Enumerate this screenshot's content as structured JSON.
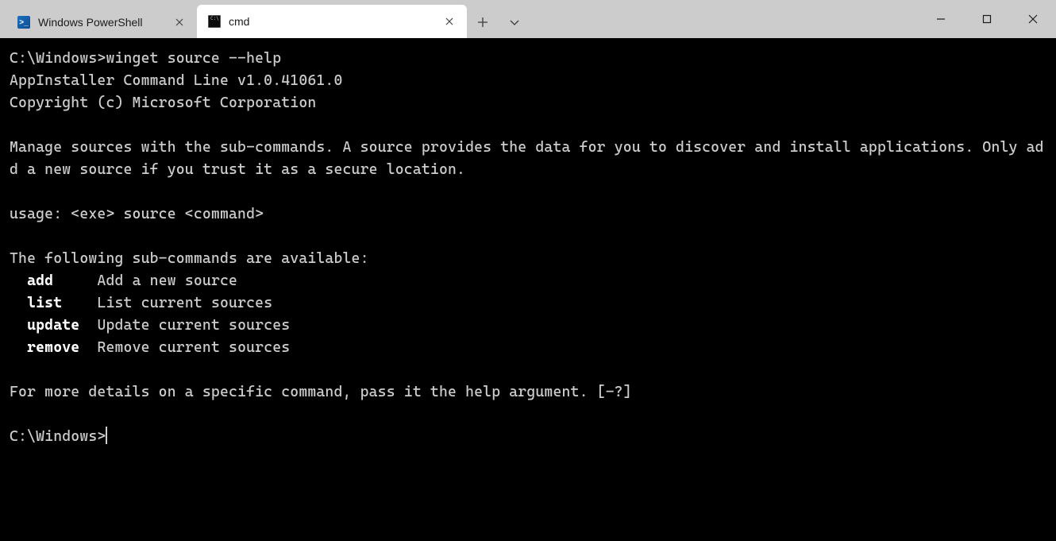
{
  "tabs": [
    {
      "label": "Windows PowerShell",
      "icon": "powershell-icon",
      "active": false
    },
    {
      "label": "cmd",
      "icon": "cmd-icon",
      "active": true
    }
  ],
  "terminal": {
    "prompt1": "C:\\Windows>",
    "command": "winget source --help",
    "line_version": "AppInstaller Command Line v1.0.41061.0",
    "line_copyright": "Copyright (c) Microsoft Corporation",
    "line_desc": "Manage sources with the sub-commands. A source provides the data for you to discover and install applications. Only add a new source if you trust it as a secure location.",
    "line_usage": "usage: <exe> source <command>",
    "line_subheader": "The following sub-commands are available:",
    "subcommands": [
      {
        "name": "add",
        "desc": "Add a new source"
      },
      {
        "name": "list",
        "desc": "List current sources"
      },
      {
        "name": "update",
        "desc": "Update current sources"
      },
      {
        "name": "remove",
        "desc": "Remove current sources"
      }
    ],
    "line_more": "For more details on a specific command, pass it the help argument. [-?]",
    "prompt2": "C:\\Windows>"
  }
}
